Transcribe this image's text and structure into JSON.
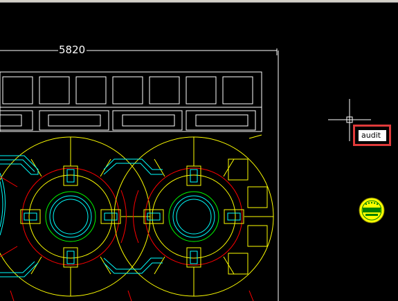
{
  "app": {
    "dimension_label": "5820",
    "command_input": "audit"
  },
  "colors": {
    "background": "#000000",
    "white": "#ffffff",
    "yellow": "#ffff00",
    "red": "#ff0000",
    "cyan": "#00ffff",
    "green": "#00ff00",
    "highlight": "#e03a3a"
  },
  "icons": {
    "crosshair": "crosshair-cursor-icon",
    "badge": "stamp-logo-icon"
  }
}
